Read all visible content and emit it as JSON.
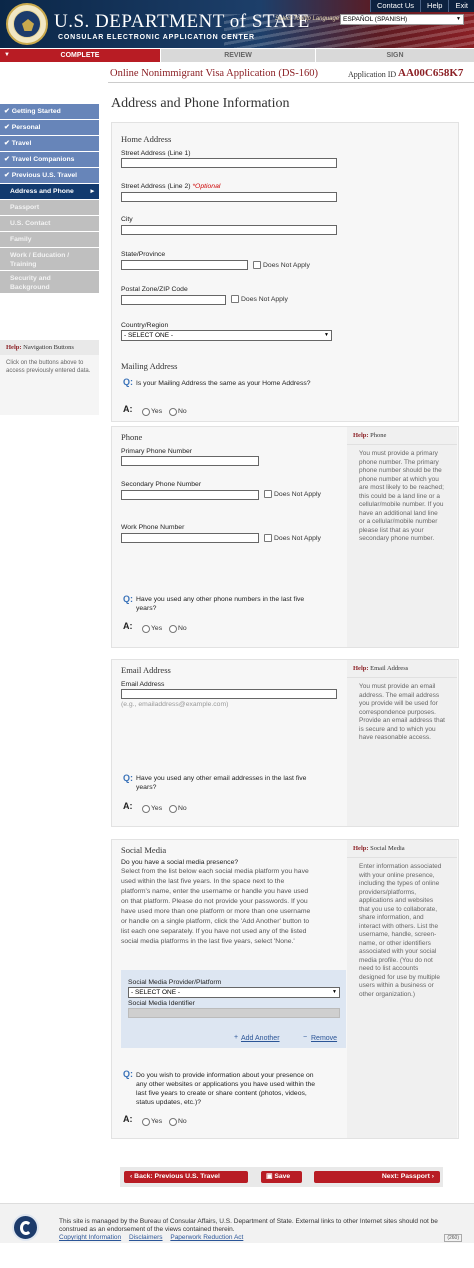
{
  "header": {
    "title": "U.S. DEPARTMENT of STATE",
    "subtitle": "CONSULAR ELECTRONIC APPLICATION CENTER",
    "links": [
      "Contact Us",
      "Help",
      "Exit"
    ],
    "language_label": "Select Tooltip Language",
    "language_value": "ESPAÑOL (SPANISH)"
  },
  "progress": {
    "complete": "COMPLETE",
    "review": "REVIEW",
    "sign": "SIGN"
  },
  "form": {
    "title": "Online Nonimmigrant Visa Application (DS-160)",
    "app_id_label": "Application ID",
    "app_id": "AA00C658K7",
    "page_title": "Address and Phone Information"
  },
  "sidebar": {
    "items": [
      {
        "label": "Getting Started",
        "state": "done"
      },
      {
        "label": "Personal",
        "state": "done"
      },
      {
        "label": "Travel",
        "state": "done"
      },
      {
        "label": "Travel Companions",
        "state": "done"
      },
      {
        "label": "Previous U.S. Travel",
        "state": "done"
      },
      {
        "label": "Address and Phone",
        "state": "current"
      },
      {
        "label": "Passport",
        "state": "future"
      },
      {
        "label": "U.S. Contact",
        "state": "future"
      },
      {
        "label": "Family",
        "state": "future"
      },
      {
        "label": "Work / Education / Training",
        "state": "future"
      },
      {
        "label": "Security and Background",
        "state": "future"
      }
    ],
    "help_label": "Help:",
    "help_title": "Navigation Buttons",
    "help_text": "Click on the buttons above to access previously entered data."
  },
  "home": {
    "title": "Home Address",
    "street1": "Street Address (Line 1)",
    "street2": "Street Address (Line 2)",
    "optional": "*Optional",
    "city": "City",
    "state": "State/Province",
    "does_not_apply": "Does Not Apply",
    "zip": "Postal Zone/ZIP Code",
    "country": "Country/Region",
    "select_one": "- SELECT ONE -"
  },
  "mailing": {
    "title": "Mailing Address",
    "question": "Is your Mailing Address the same as your Home Address?"
  },
  "qa": {
    "q": "Q:",
    "a": "A:",
    "yes": "Yes",
    "no": "No"
  },
  "phone": {
    "title": "Phone",
    "primary": "Primary Phone Number",
    "secondary": "Secondary Phone Number",
    "work": "Work Phone Number",
    "does_not_apply": "Does Not Apply",
    "question_l1": "Have you used any other phone numbers in the last five",
    "question_l2": "years?",
    "help_label": "Help:",
    "help_title": "Phone",
    "help_text": "You must provide a primary phone number. The primary phone number should be the phone number at which you are most likely to be reached; this could be a land line or a cellular/mobile number. If you have an additional land line or a cellular/mobile number please list that as your secondary phone number."
  },
  "email": {
    "title": "Email Address",
    "label": "Email Address",
    "hint": "(e.g., emailaddress@example.com)",
    "question_l1": "Have you used any other email addresses in the last five",
    "question_l2": "years?",
    "help_label": "Help:",
    "help_title": "Email Address",
    "help_text": "You must provide an email address.  The email address you provide will be used for correspondence purposes.  Provide an email address that is secure and to which you have reasonable access."
  },
  "social": {
    "title": "Social Media",
    "question": "Do you have a social media presence?",
    "paragraph": [
      "Select from the list below each social media platform you have",
      "used within the last five years. In the space next to the",
      "platform's name, enter the username or handle you have used",
      "on that platform. Please do not provide your passwords. If you",
      "have used more than one platform or more than one username",
      "or handle on a single platform, click the 'Add Another' button to",
      "list each one separately. If you have not used any of the listed",
      "social media platforms in the last five years, select 'None.'"
    ],
    "provider_label": "Social Media Provider/Platform",
    "select_one": "- SELECT ONE -",
    "identifier_label": "Social Media Identifier",
    "add_another": "Add Another",
    "remove": "Remove",
    "question2": [
      "Do you wish to provide information about your presence on",
      "any other websites or applications you have used within the",
      "last five years to create or share content (photos, videos,",
      "status updates, etc.)?"
    ],
    "help_label": "Help:",
    "help_title": "Social Media",
    "help_text": "Enter information associated with your online presence, including the types of online providers/platforms, applications and websites that you use to collaborate, share information, and interact with others. List the username, handle, screen-name, or other identifiers associated with your social media profile. (You do not need to list accounts designed for use by multiple users within a business or other organization.)"
  },
  "buttons": {
    "back": "Back: Previous U.S. Travel",
    "save": "Save",
    "next": "Next: Passport"
  },
  "footer": {
    "text": "This site is managed by the Bureau of Consular Affairs, U.S. Department of State. External links to other Internet sites should not be construed as an endorsement of the views contained therein.",
    "links": [
      "Copyright Information",
      "Disclaimers",
      "Paperwork Reduction Act"
    ],
    "code": "(260)"
  }
}
